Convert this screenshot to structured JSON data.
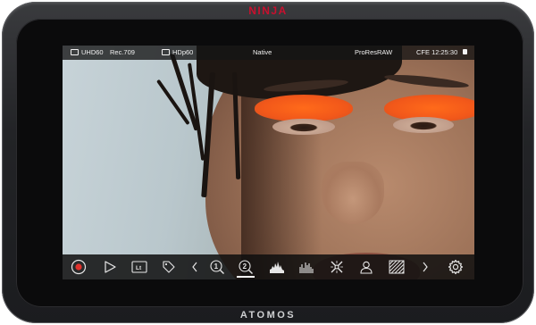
{
  "device": {
    "brand_top": "NINJA",
    "brand_bottom": "ATOMOS",
    "brand_top_color": "#c8102e"
  },
  "status_bar": {
    "input_resolution": "UHD60",
    "color_space": "Rec.709",
    "output_format": "HDp60",
    "mode": "Native",
    "codec": "ProResRAW",
    "timecode": "CFE 12:25:30",
    "input_icon": "input-icon",
    "output_icon": "output-icon",
    "lock_icon": "lock-icon"
  },
  "toolbar": {
    "items": [
      {
        "name": "record-button",
        "icon": "record-icon",
        "color": "#e0322c"
      },
      {
        "name": "play-button",
        "icon": "play-icon"
      },
      {
        "name": "lut-button",
        "icon": "lut-icon",
        "label": "Lt"
      },
      {
        "name": "tag-button",
        "icon": "tag-icon"
      },
      {
        "name": "prev-page-button",
        "icon": "chevron-left-icon"
      },
      {
        "name": "zoom-1-button",
        "icon": "magnifier-1-icon",
        "label": "1"
      },
      {
        "name": "zoom-2-button",
        "icon": "magnifier-2-icon",
        "label": "2",
        "active": true
      },
      {
        "name": "waveform-button",
        "icon": "waveform-icon"
      },
      {
        "name": "vectorscope-button",
        "icon": "histogram-icon"
      },
      {
        "name": "focus-peaking-button",
        "icon": "focus-peaking-icon"
      },
      {
        "name": "skin-tone-button",
        "icon": "person-icon"
      },
      {
        "name": "zebra-button",
        "icon": "zebra-icon"
      },
      {
        "name": "next-page-button",
        "icon": "chevron-right-icon"
      },
      {
        "name": "settings-button",
        "icon": "gear-icon"
      }
    ]
  }
}
